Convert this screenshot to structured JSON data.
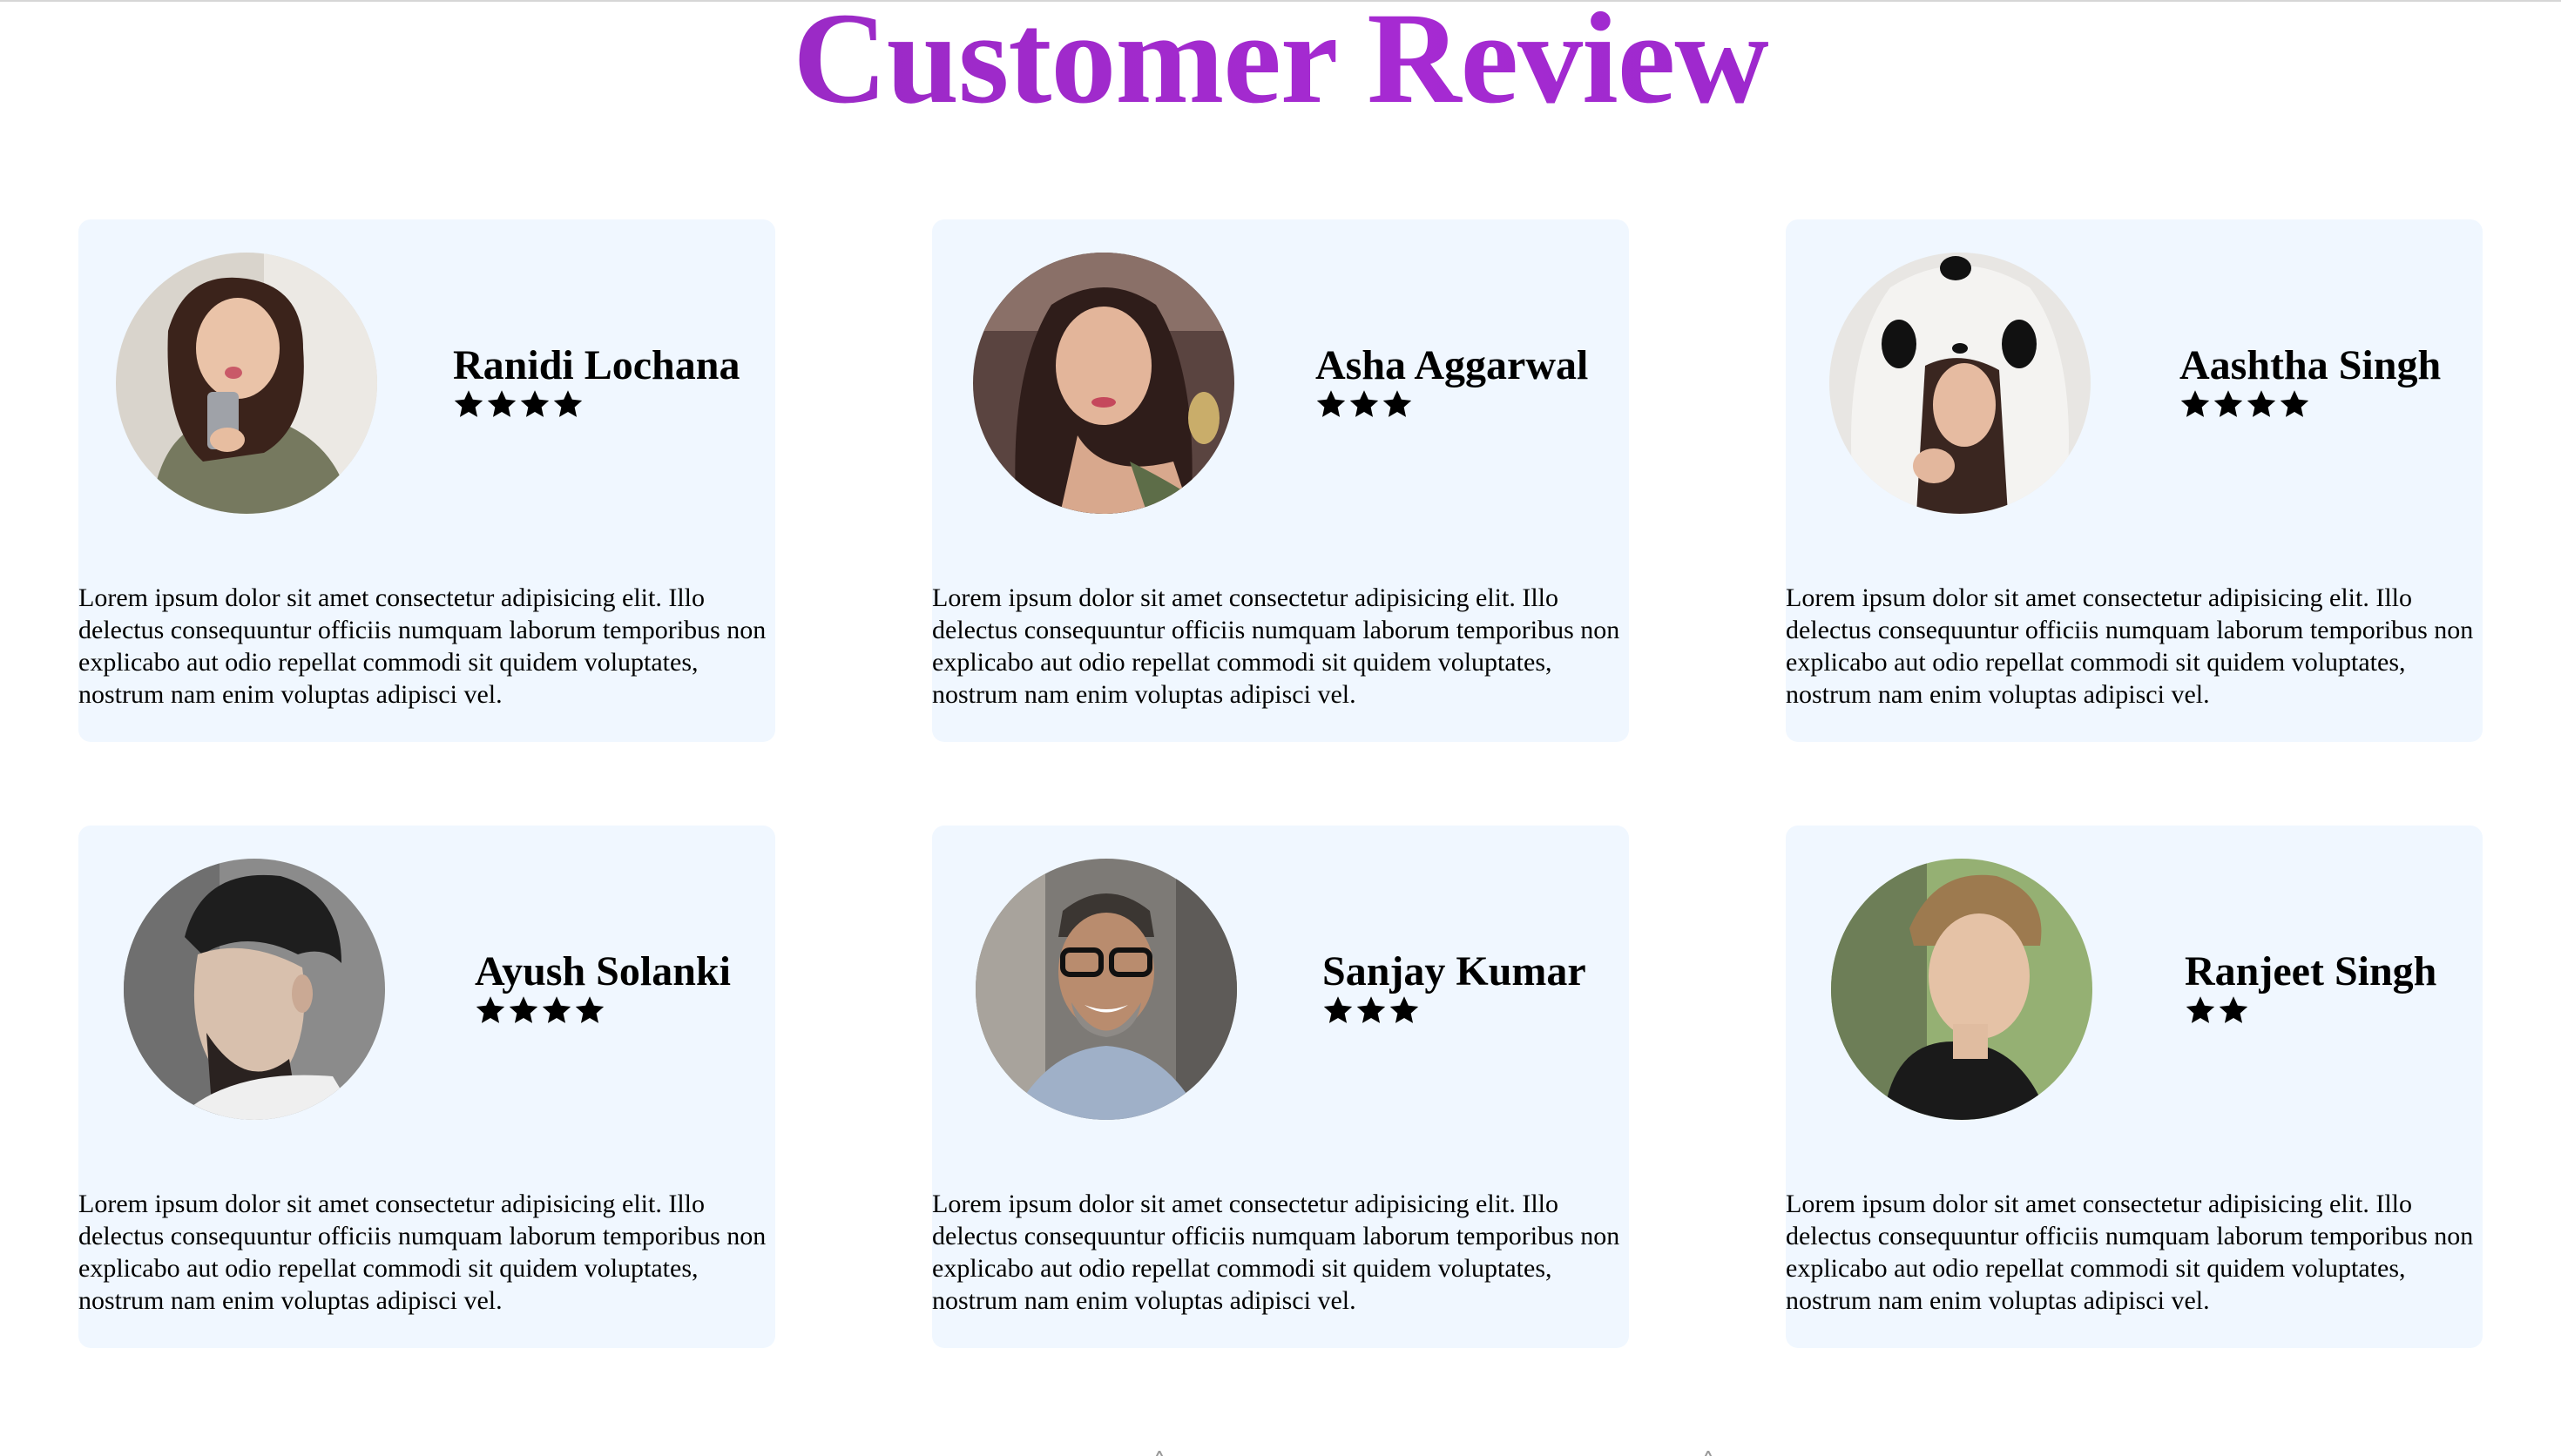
{
  "page": {
    "title": "Customer Review",
    "accent_color": "#9b2ccc",
    "card_background": "#f0f7ff"
  },
  "reviews": [
    {
      "name": "Ranidi Lochana",
      "rating": 4,
      "text": "Lorem ipsum dolor sit amet consectetur adipisicing elit. Illo delectus consequuntur officiis numquam laborum temporibus non explicabo aut odio repellat commodi sit quidem voluptates, nostrum nam enim voluptas adipisci vel.",
      "avatar_icon": "woman-selfie-photo"
    },
    {
      "name": "Asha Aggarwal",
      "rating": 3,
      "text": "Lorem ipsum dolor sit amet consectetur adipisicing elit. Illo delectus consequuntur officiis numquam laborum temporibus non explicabo aut odio repellat commodi sit quidem voluptates, nostrum nam enim voluptas adipisci vel.",
      "avatar_icon": "woman-portrait-photo"
    },
    {
      "name": "Aashtha Singh",
      "rating": 4,
      "text": "Lorem ipsum dolor sit amet consectetur adipisicing elit. Illo delectus consequuntur officiis numquam laborum temporibus non explicabo aut odio repellat commodi sit quidem voluptates, nostrum nam enim voluptas adipisci vel.",
      "avatar_icon": "woman-panda-hood-photo"
    },
    {
      "name": "Ayush Solanki",
      "rating": 4,
      "text": "Lorem ipsum dolor sit amet consectetur adipisicing elit. Illo delectus consequuntur officiis numquam laborum temporibus non explicabo aut odio repellat commodi sit quidem voluptates, nostrum nam enim voluptas adipisci vel.",
      "avatar_icon": "man-profile-photo"
    },
    {
      "name": "Sanjay Kumar",
      "rating": 3,
      "text": "Lorem ipsum dolor sit amet consectetur adipisicing elit. Illo delectus consequuntur officiis numquam laborum temporibus non explicabo aut odio repellat commodi sit quidem voluptates, nostrum nam enim voluptas adipisci vel.",
      "avatar_icon": "man-glasses-photo"
    },
    {
      "name": "Ranjeet Singh",
      "rating": 2,
      "text": "Lorem ipsum dolor sit amet consectetur adipisicing elit. Illo delectus consequuntur officiis numquam laborum temporibus non explicabo aut odio repellat commodi sit quidem voluptates, nostrum nam enim voluptas adipisci vel.",
      "avatar_icon": "young-man-photo"
    }
  ]
}
